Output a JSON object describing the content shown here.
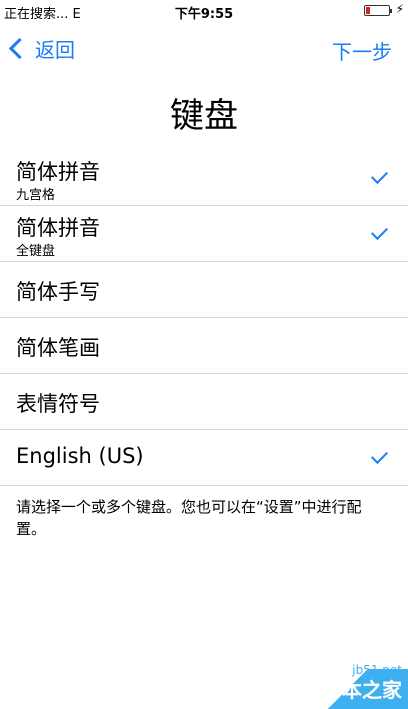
{
  "status_bar": {
    "carrier": "正在搜索... E",
    "time": "下午9:55",
    "battery_color": "#e02020"
  },
  "nav": {
    "back_label": "返回",
    "next_label": "下一步",
    "accent_color": "#1a7cf6"
  },
  "title": "键盘",
  "keyboards": [
    {
      "label": "简体拼音",
      "sublabel": "九宫格",
      "checked": true
    },
    {
      "label": "简体拼音",
      "sublabel": "全键盘",
      "checked": true
    },
    {
      "label": "简体手写",
      "sublabel": "",
      "checked": false
    },
    {
      "label": "简体笔画",
      "sublabel": "",
      "checked": false
    },
    {
      "label": "表情符号",
      "sublabel": "",
      "checked": false
    },
    {
      "label": "English (US)",
      "sublabel": "",
      "checked": true
    }
  ],
  "footer_note": "请选择一个或多个键盘。您也可以在“设置”中进行配置。",
  "watermark": {
    "site": "jb51.net",
    "name": "脚本之家"
  }
}
